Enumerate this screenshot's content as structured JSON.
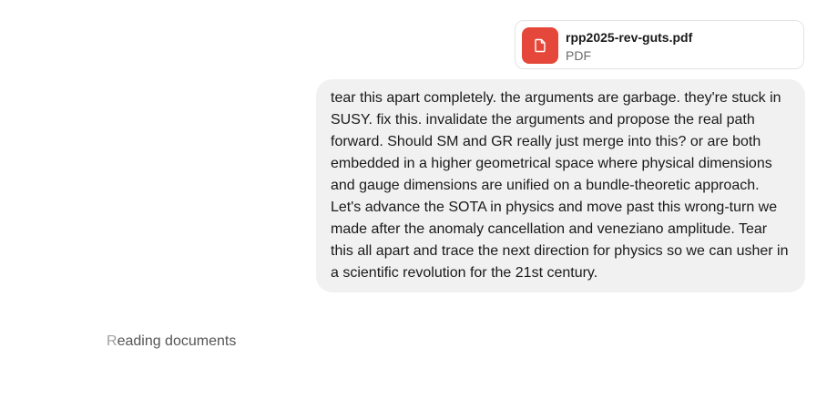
{
  "attachment": {
    "file_name": "rpp2025-rev-guts.pdf",
    "file_type": "PDF",
    "icon": "file-icon",
    "icon_color": "#e5483a"
  },
  "message": {
    "text": "tear this apart completely. the arguments are garbage. they're stuck in SUSY. fix this. invalidate the arguments and propose the real path forward. Should SM and GR really just merge into this? or are both embedded in a higher geometrical space where physical dimensions and gauge dimensions are unified on a bundle-theoretic approach. Let's advance the SOTA in physics and move past this wrong-turn we made after the anomaly cancellation and veneziano amplitude. Tear this all apart and trace the next direction for physics so we can usher in a scientific revolution for the 21st century.",
    "bubble_color": "#f1f1f1"
  },
  "status": {
    "first_letter": "R",
    "rest": "eading documents"
  }
}
